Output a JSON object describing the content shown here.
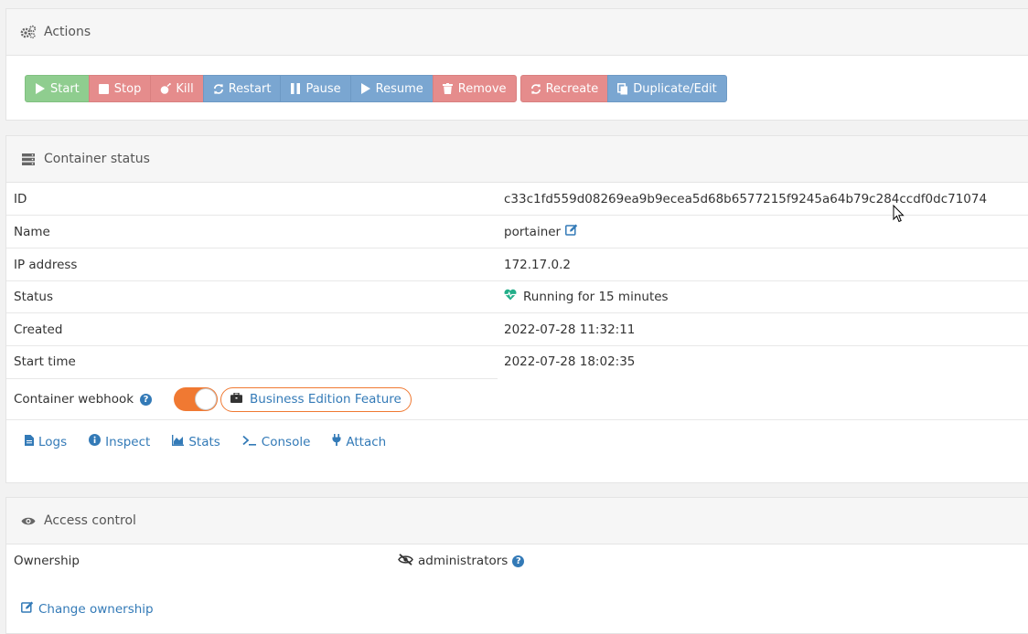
{
  "actions": {
    "title": "Actions",
    "buttons": {
      "start": "Start",
      "stop": "Stop",
      "kill": "Kill",
      "restart": "Restart",
      "pause": "Pause",
      "resume": "Resume",
      "remove": "Remove",
      "recreate": "Recreate",
      "duplicate": "Duplicate/Edit"
    }
  },
  "status": {
    "title": "Container status",
    "rows": {
      "id": {
        "label": "ID",
        "value": "c33c1fd559d08269ea9b9ecea5d68b6577215f9245a64b79c284ccdf0dc71074"
      },
      "name": {
        "label": "Name",
        "value": "portainer"
      },
      "ip": {
        "label": "IP address",
        "value": "172.17.0.2"
      },
      "status": {
        "label": "Status",
        "value": "Running for 15 minutes"
      },
      "created": {
        "label": "Created",
        "value": "2022-07-28 11:32:11"
      },
      "start": {
        "label": "Start time",
        "value": "2022-07-28 18:02:35"
      }
    },
    "webhook": {
      "label": "Container webhook",
      "badge": "Business Edition Feature",
      "enabled": true
    },
    "links": {
      "logs": "Logs",
      "inspect": "Inspect",
      "stats": "Stats",
      "console": "Console",
      "attach": "Attach"
    }
  },
  "access": {
    "title": "Access control",
    "ownership_label": "Ownership",
    "ownership_value": "administrators",
    "change_ownership": "Change ownership"
  },
  "colors": {
    "success": "#8fcd8f",
    "danger": "#e58c8c",
    "primary": "#7aa6d1",
    "accent_orange": "#f07932",
    "link": "#337ab7",
    "running_green": "#23ae89"
  }
}
